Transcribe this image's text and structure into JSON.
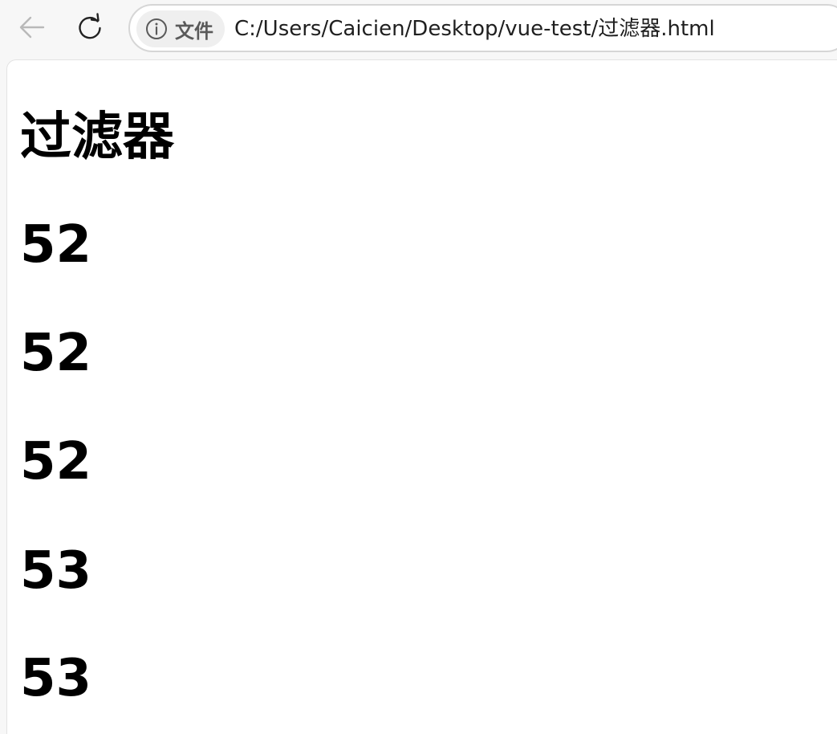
{
  "toolbar": {
    "back_icon": "arrow-left-icon",
    "reload_icon": "reload-icon"
  },
  "address_bar": {
    "chip_icon": "info-icon",
    "chip_label": "文件",
    "url": "C:/Users/Caicien/Desktop/vue-test/过滤器.html"
  },
  "page": {
    "title": "过滤器",
    "values": [
      "52",
      "52",
      "52",
      "53",
      "53"
    ]
  }
}
